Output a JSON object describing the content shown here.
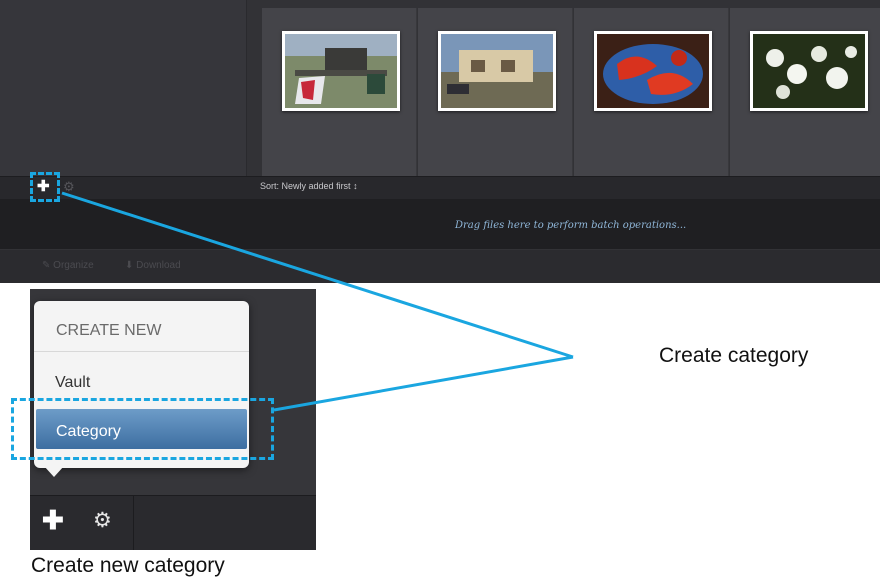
{
  "toolbar": {
    "add_icon": "plus-icon",
    "settings_icon": "gear-icon",
    "sort_label": "Sort:",
    "sort_value": "Newly added first",
    "sort_arrow": "↕"
  },
  "dropzone": {
    "text": "Drag files here to perform batch operations..."
  },
  "actions": {
    "organize": "Organize",
    "download": "Download"
  },
  "thumbnails": [
    "saw-photo",
    "building-photo",
    "lobster-photo",
    "flowers-photo"
  ],
  "menu": {
    "header": "CREATE NEW",
    "items": [
      "Vault",
      "Category"
    ],
    "selected": "Category",
    "selected_color": "#4a7db3"
  },
  "annotations": {
    "callout": "Create category",
    "caption": "Create new category",
    "accent_color": "#1aa6e0"
  }
}
